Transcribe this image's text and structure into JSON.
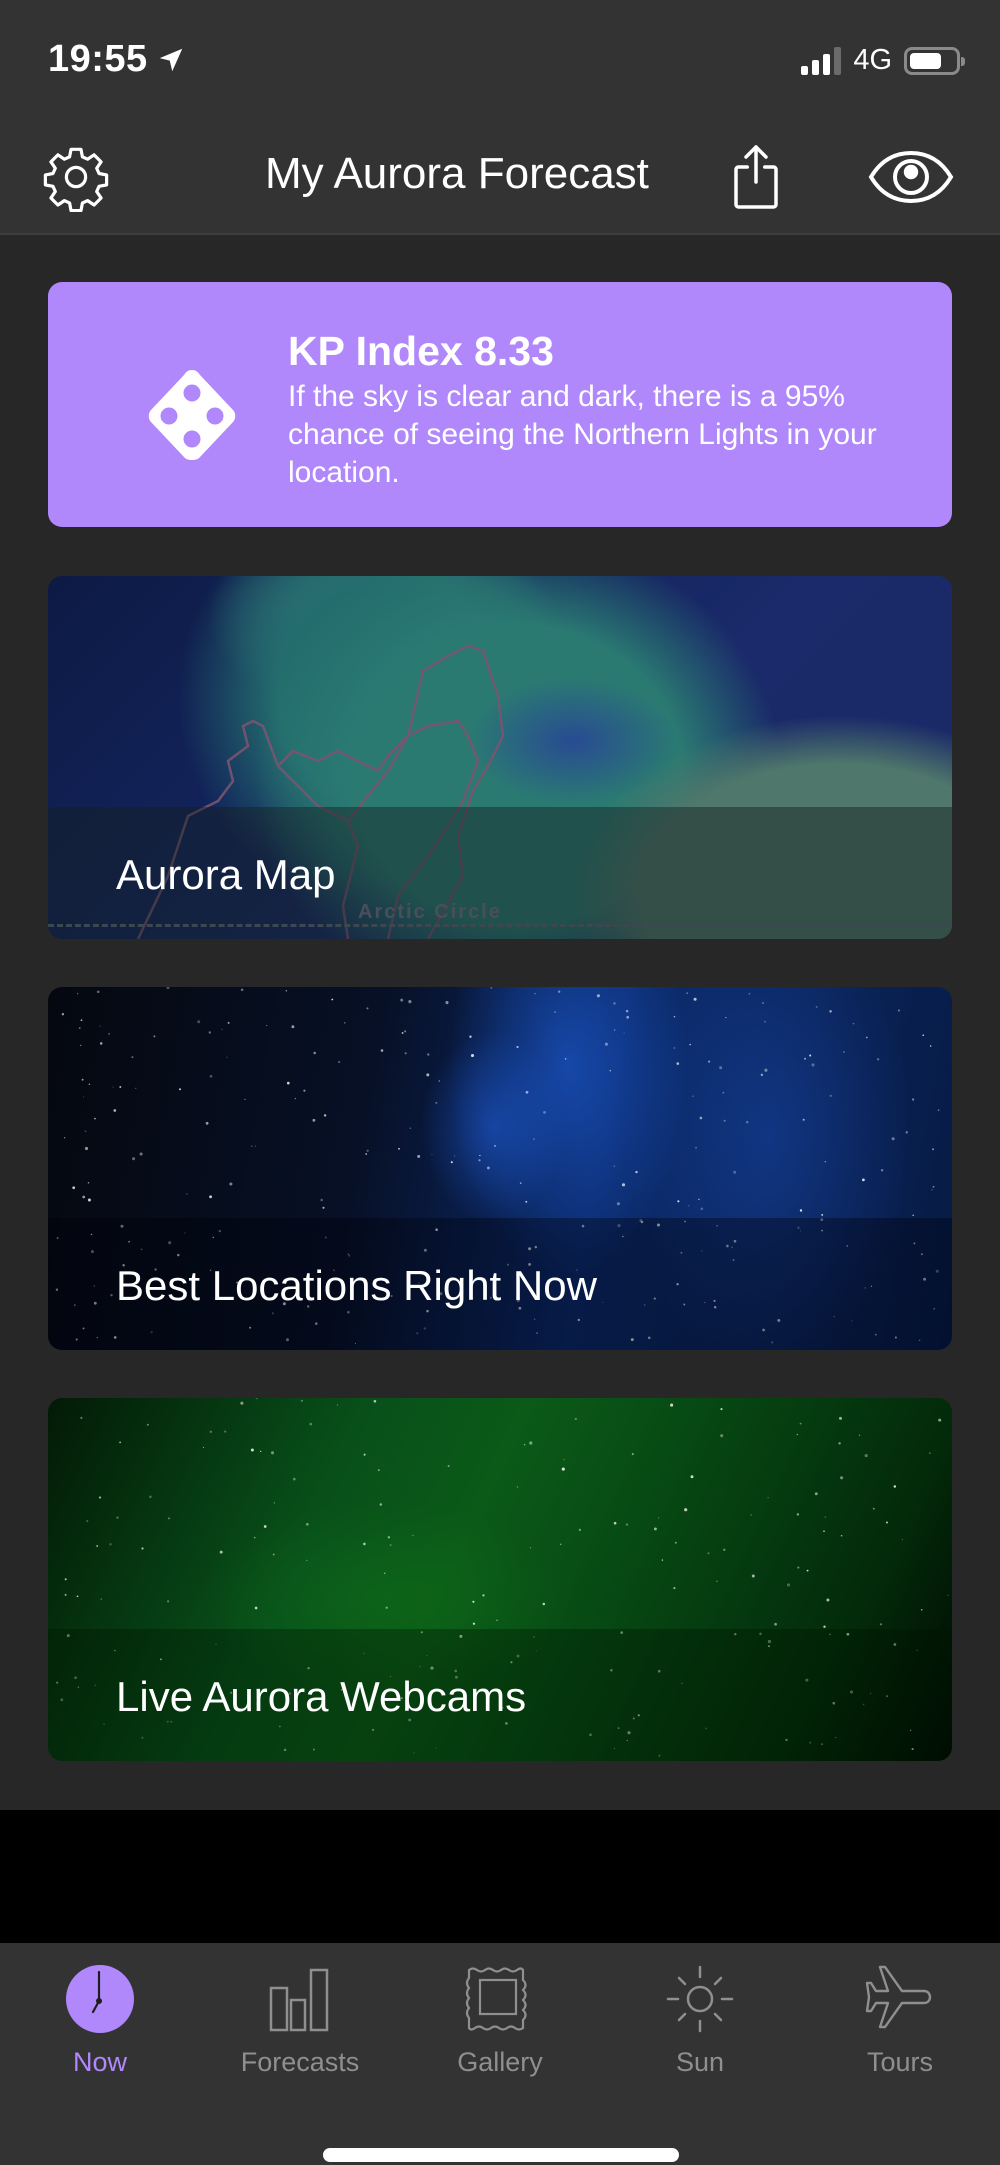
{
  "status_bar": {
    "time": "19:55",
    "location_icon": "location-arrow-icon",
    "network": "4G",
    "signal_bars_active": 3,
    "signal_bars_total": 4,
    "battery_level": 0.7
  },
  "header": {
    "title": "My Aurora Forecast",
    "settings_icon": "gear-icon",
    "share_icon": "share-icon",
    "view_icon": "eye-icon"
  },
  "kp_card": {
    "icon": "dice-icon",
    "title": "KP Index 8.33",
    "kp_value": 8.33,
    "chance_percent": 95,
    "description": "If the sky is clear and dark, there is a 95% chance of seeing the Northern Lights in your location.",
    "color": "#b088fc"
  },
  "tiles": [
    {
      "label": "Aurora Map",
      "map_annotation": "Arctic Circle"
    },
    {
      "label": "Best Locations Right Now"
    },
    {
      "label": "Live Aurora Webcams"
    }
  ],
  "tabbar": {
    "accent_color": "#b088fc",
    "inactive_color": "#8f8f8f",
    "items": [
      {
        "label": "Now",
        "icon": "clock-icon",
        "active": true
      },
      {
        "label": "Forecasts",
        "icon": "bar-chart-icon",
        "active": false
      },
      {
        "label": "Gallery",
        "icon": "picture-frame-icon",
        "active": false
      },
      {
        "label": "Sun",
        "icon": "sun-icon",
        "active": false
      },
      {
        "label": "Tours",
        "icon": "airplane-icon",
        "active": false
      }
    ]
  }
}
